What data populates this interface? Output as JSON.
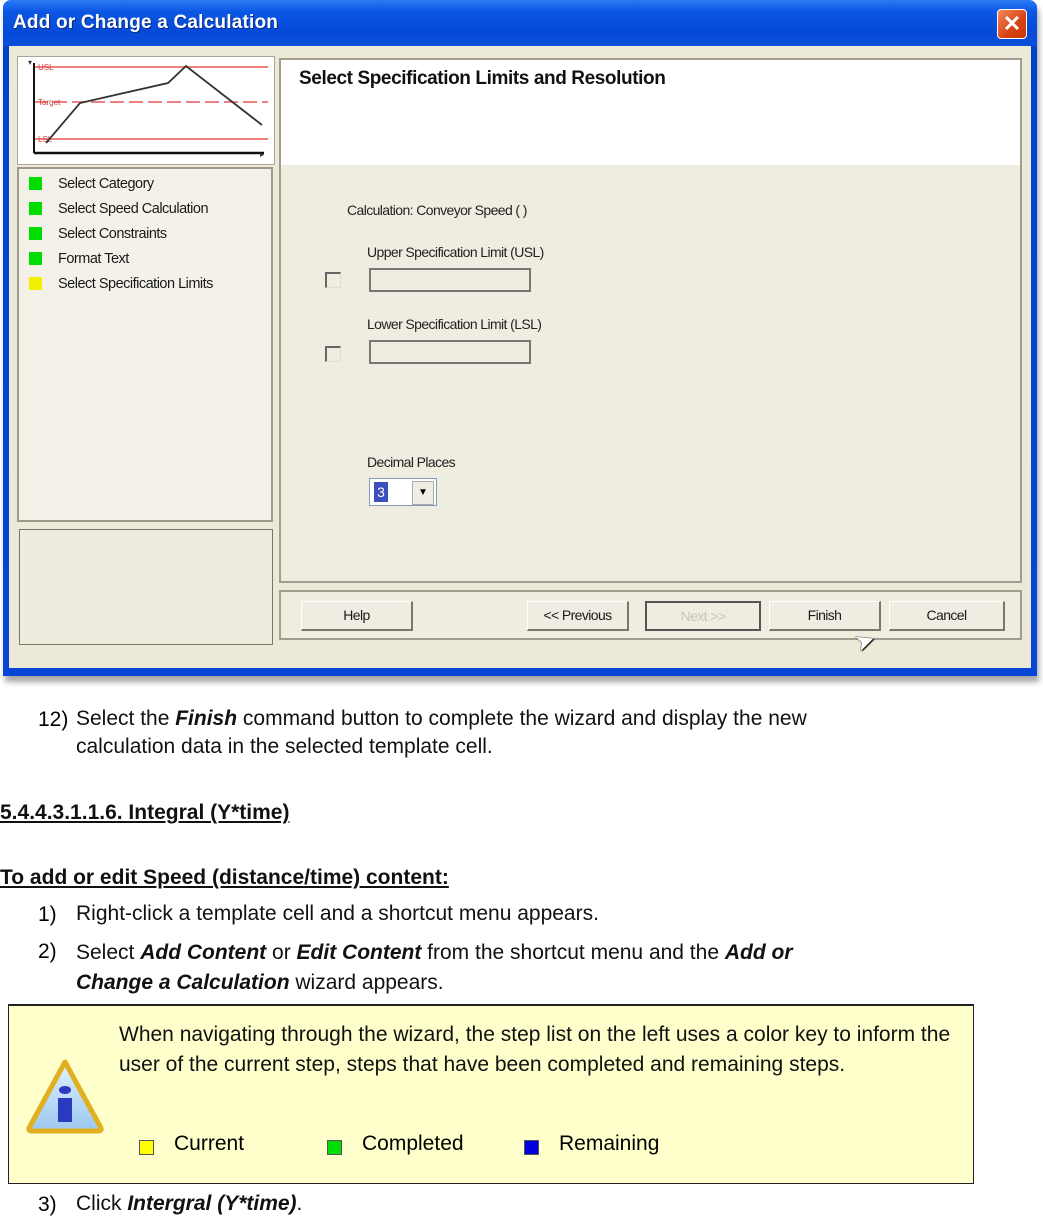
{
  "window": {
    "title": "Add or Change a Calculation",
    "close_icon": "close-x"
  },
  "preview_chart": {
    "labels": {
      "upper": "USL",
      "target": "Target",
      "lower": "LSL"
    },
    "line_color": "#333333",
    "limit_color": "#f08080"
  },
  "steps": {
    "items": [
      {
        "label": "Select Category",
        "status": "completed",
        "color": "#00dd00"
      },
      {
        "label": "Select Speed Calculation",
        "status": "completed",
        "color": "#00dd00"
      },
      {
        "label": "Select Constraints",
        "status": "completed",
        "color": "#00dd00"
      },
      {
        "label": "Format Text",
        "status": "completed",
        "color": "#00dd00"
      },
      {
        "label": "Select Specification Limits",
        "status": "current",
        "color": "#f0f000"
      }
    ]
  },
  "main": {
    "title": "Select Specification Limits and Resolution",
    "calculation_label": "Calculation: Conveyor Speed ( )",
    "usl": {
      "label": "Upper Specification Limit (USL)",
      "value": "",
      "checked": false
    },
    "lsl": {
      "label": "Lower Specification Limit (LSL)",
      "value": "",
      "checked": false
    },
    "decimal_places": {
      "label": "Decimal Places",
      "value": "3"
    }
  },
  "buttons": {
    "help": "Help",
    "previous": "<< Previous",
    "next": "Next >>",
    "finish": "Finish",
    "cancel": "Cancel"
  },
  "document": {
    "step12": {
      "number": "12)",
      "pre": "Select the ",
      "bold": "Finish",
      "post": " command button to complete the wizard and display the new",
      "line2": "calculation data in the selected template cell."
    },
    "section_heading": "5.4.4.3.1.1.6. Integral (Y*time)",
    "procedure_heading": "To add or edit Speed (distance/time) content:",
    "step1": {
      "number": "1)",
      "text": "Right-click a template cell and a shortcut menu appears."
    },
    "step2": {
      "number": "2)",
      "t1": "Select ",
      "b1": "Add Content",
      "t2": " or ",
      "b2": "Edit Content",
      "t3": " from the shortcut menu and the ",
      "b3": "Add or",
      "b4": "Change a Calculation",
      "t4": " wizard appears."
    },
    "note": {
      "text": "When navigating through the wizard, the step list on the left uses a color key to inform the user of the current step, steps that have been completed and remaining steps.",
      "legend": [
        {
          "label": "Current",
          "color": "#ffff00"
        },
        {
          "label": "Completed",
          "color": "#00dd00"
        },
        {
          "label": "Remaining",
          "color": "#0000dd"
        }
      ]
    },
    "step3": {
      "number": "3)",
      "t1": "Click ",
      "b1": "Intergral (Y*time)",
      "t2": "."
    }
  }
}
